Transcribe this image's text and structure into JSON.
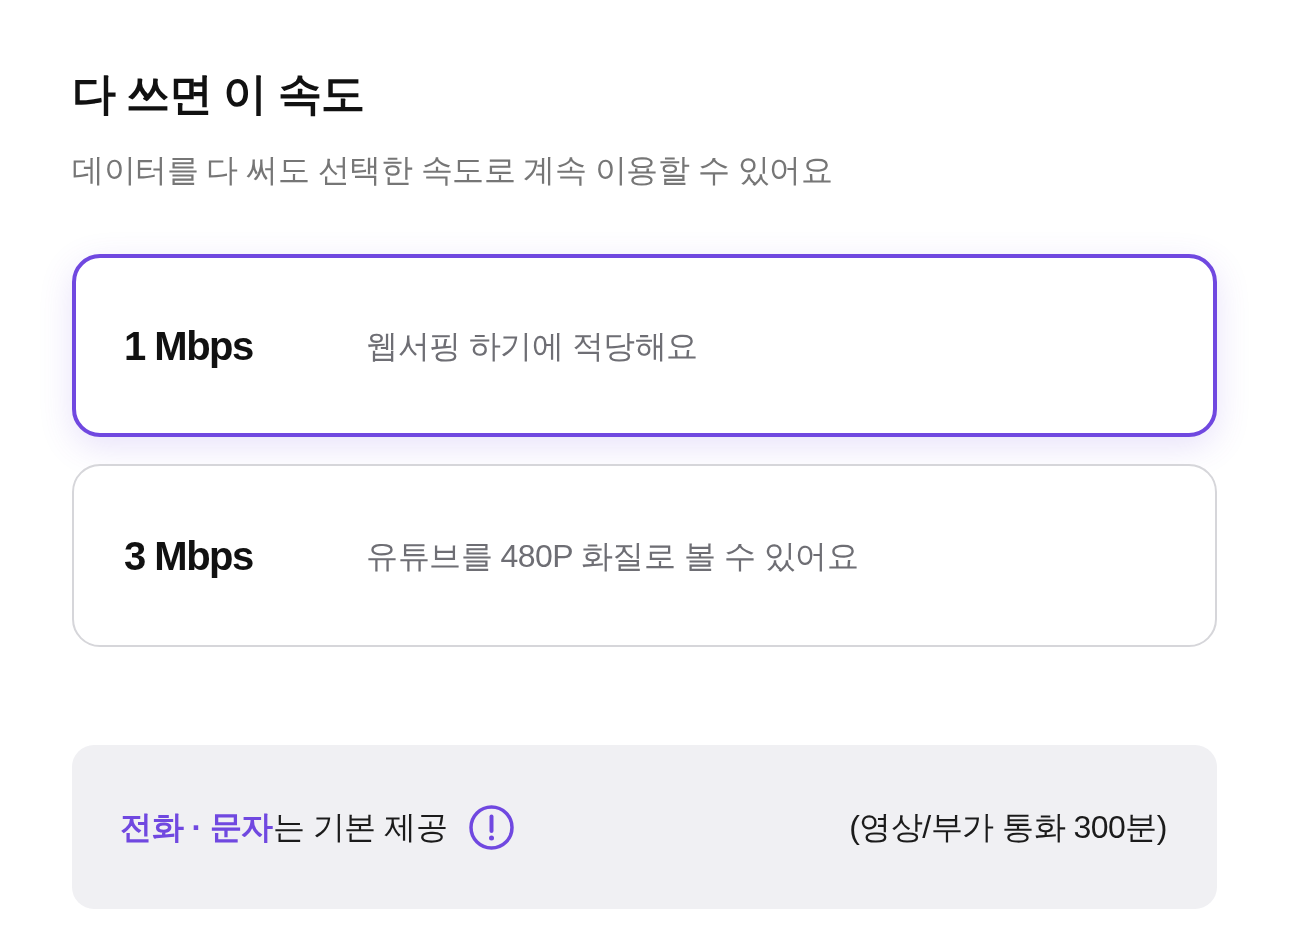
{
  "header": {
    "title": "다 쓰면 이 속도",
    "subtitle": "데이터를 다 써도 선택한 속도로 계속 이용할 수 있어요"
  },
  "speed_options": [
    {
      "speed": "1 Mbps",
      "description": "웹서핑 하기에 적당해요",
      "selected": true
    },
    {
      "speed": "3 Mbps",
      "description": "유튜브를 480P 화질로 볼 수 있어요",
      "selected": false
    }
  ],
  "notice": {
    "text": "**전화 · 문자**는 기본 제공",
    "detail": "(영상/부가 통화 300분)"
  }
}
